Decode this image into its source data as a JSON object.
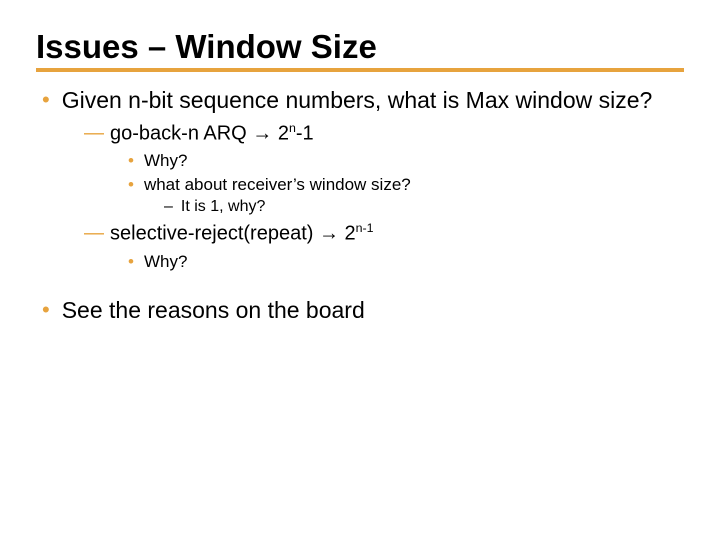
{
  "title": "Issues – Window Size",
  "bullets": {
    "q1": "Given n-bit sequence numbers, what is Max window size?",
    "gbn_pre": "go-back-n ARQ ",
    "arrow": "→",
    "gbn_post_a": " 2",
    "gbn_post_exp": "n",
    "gbn_post_b": "-1",
    "why": "Why?",
    "recv_q": "what about receiver’s window size?",
    "recv_a": "It is 1, why?",
    "sr_pre": "selective-reject(repeat) ",
    "sr_post_a": " 2",
    "sr_post_exp": "n-1",
    "final": "See the reasons on the board"
  }
}
